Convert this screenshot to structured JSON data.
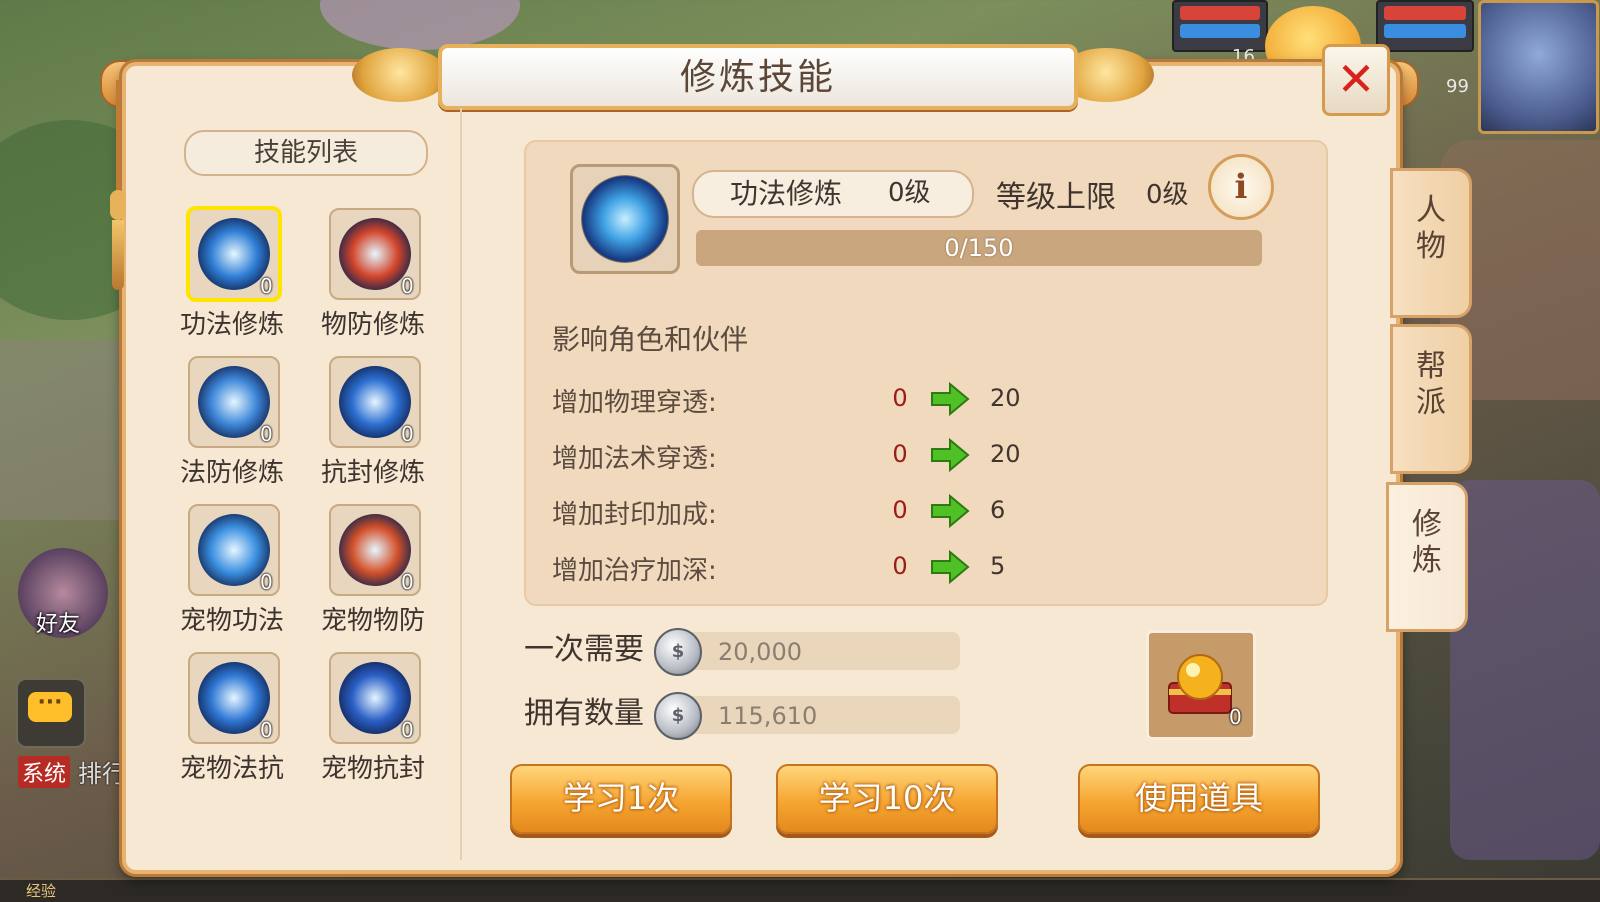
{
  "window": {
    "title": "修炼技能",
    "close_label": "✕"
  },
  "hud": {
    "level_left": "16",
    "level_right": "99"
  },
  "world": {
    "friend_label": "好友",
    "chat_icon": "···",
    "system_label": "系统",
    "rank_label": "排行",
    "exp_label": "经验"
  },
  "skill_list": {
    "title": "技能列表",
    "items": [
      {
        "name": "功法修炼",
        "level": "0",
        "icon": "blue-dragon-orb",
        "color": "#2f7fd6",
        "selected": true
      },
      {
        "name": "物防修炼",
        "level": "0",
        "icon": "red-shield-orb",
        "color": "#d2452b"
      },
      {
        "name": "法防修炼",
        "level": "0",
        "icon": "blue-shield-orb",
        "color": "#3d86d8"
      },
      {
        "name": "抗封修炼",
        "level": "0",
        "icon": "blue-seal-orb",
        "color": "#2b6ed0"
      },
      {
        "name": "宠物功法",
        "level": "0",
        "icon": "pet-magic-orb",
        "color": "#3a8fe0"
      },
      {
        "name": "宠物物防",
        "level": "0",
        "icon": "pet-defense-orb",
        "color": "#d2502a"
      },
      {
        "name": "宠物法抗",
        "level": "0",
        "icon": "pet-resist-orb",
        "color": "#2e77d4"
      },
      {
        "name": "宠物抗封",
        "level": "0",
        "icon": "pet-antiseal-orb",
        "color": "#2a5fc6"
      }
    ]
  },
  "detail": {
    "skill_name": "功法修炼",
    "skill_level": "0级",
    "cap_label": "等级上限",
    "cap_value": "0级",
    "info_label": "i",
    "progress_text": "0/150",
    "progress": 0,
    "affect_label": "影响角色和伙伴",
    "stats": [
      {
        "label": "增加物理穿透:",
        "current": "0",
        "next": "20"
      },
      {
        "label": "增加法术穿透:",
        "current": "0",
        "next": "20"
      },
      {
        "label": "增加封印加成:",
        "current": "0",
        "next": "6"
      },
      {
        "label": "增加治疗加深:",
        "current": "0",
        "next": "5"
      }
    ]
  },
  "cost": {
    "need_label": "一次需要",
    "need_value": "20,000",
    "own_label": "拥有数量",
    "own_value": "115,610",
    "coin_icon": "silver-coin-icon",
    "coin_glyph": "$"
  },
  "actions": {
    "learn_once": "学习1次",
    "learn_ten": "学习10次",
    "use_item": "使用道具",
    "item_count": "0"
  },
  "side_tabs": [
    {
      "label": "人物"
    },
    {
      "label": "帮派"
    },
    {
      "label": "修炼",
      "active": true
    }
  ],
  "colors": {
    "panel_bg": "#f7e8d4",
    "accent_orange": "#f5a532",
    "value_red": "#9c1b15",
    "arrow_green": "#4fc026"
  }
}
